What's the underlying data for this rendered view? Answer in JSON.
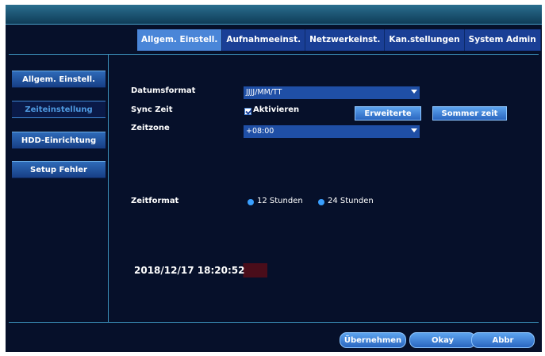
{
  "tabs": [
    {
      "label": "Allgem. Einstell.",
      "active": true
    },
    {
      "label": "Aufnahmeeinst.",
      "active": false
    },
    {
      "label": "Netzwerkeinst.",
      "active": false
    },
    {
      "label": "Kan.stellungen",
      "active": false
    },
    {
      "label": "System Admin",
      "active": false
    }
  ],
  "sidebar": {
    "items": [
      {
        "label": "Allgem. Einstell.",
        "active": false
      },
      {
        "label": "Zeiteinstellung",
        "active": true
      },
      {
        "label": "HDD-Einrichtung",
        "active": false
      },
      {
        "label": "Setup Fehler",
        "active": false
      }
    ]
  },
  "form": {
    "date_format_label": "Datumsformat",
    "date_format_value": "JJJJ/MM/TT",
    "sync_label": "Sync Zeit",
    "sync_checkbox_label": "Aktivieren",
    "sync_checked": true,
    "advanced_button": "Erweiterte",
    "summer_time_button": "Sommer zeit",
    "timezone_label": "Zeitzone",
    "timezone_value": "+08:00",
    "time_format_label": "Zeitformat",
    "time_format_options": [
      "12 Stunden",
      "24 Stunden"
    ],
    "current_datetime": "2018/12/17 18:20:52"
  },
  "footer": {
    "apply_button": "Übernehmen",
    "ok_button": "Okay",
    "cancel_button": "Abbr"
  },
  "colors": {
    "background": "#06102a",
    "accent": "#3d95bf",
    "button": "#2a66c0",
    "active_tab": "#4a86d8"
  }
}
